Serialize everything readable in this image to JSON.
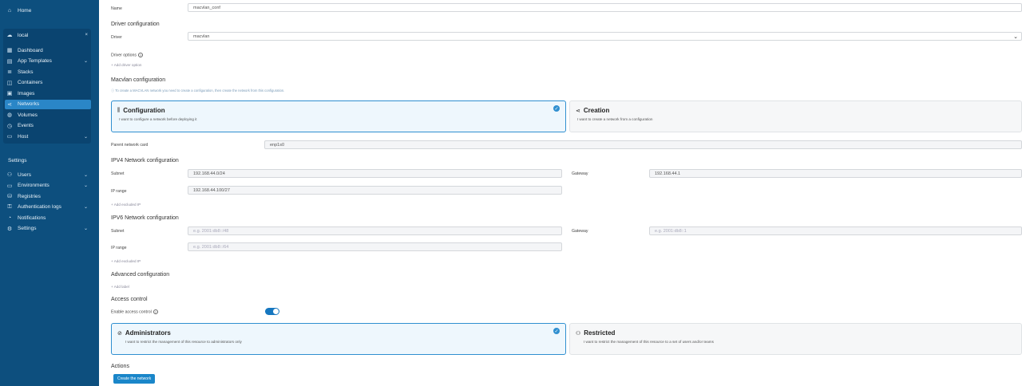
{
  "sidebar": {
    "home": "Home",
    "environment": "local",
    "env_items": [
      {
        "label": "Dashboard",
        "icon": "dashboard-icon"
      },
      {
        "label": "App Templates",
        "icon": "templates-icon"
      },
      {
        "label": "Stacks",
        "icon": "stacks-icon"
      },
      {
        "label": "Containers",
        "icon": "containers-icon"
      },
      {
        "label": "Images",
        "icon": "images-icon"
      },
      {
        "label": "Networks",
        "icon": "networks-icon"
      },
      {
        "label": "Volumes",
        "icon": "volumes-icon"
      },
      {
        "label": "Events",
        "icon": "events-icon"
      },
      {
        "label": "Host",
        "icon": "host-icon"
      }
    ],
    "settings_header": "Settings",
    "settings_items": [
      {
        "label": "Users"
      },
      {
        "label": "Environments"
      },
      {
        "label": "Registries"
      },
      {
        "label": "Authentication logs"
      },
      {
        "label": "Notifications"
      },
      {
        "label": "Settings"
      }
    ]
  },
  "form": {
    "name_label": "Name",
    "name_value": "macvlan_conf",
    "driver_section": "Driver configuration",
    "driver_label": "Driver",
    "driver_value": "macvlan",
    "driver_options_label": "Driver options",
    "add_driver_option": "+ Add driver option",
    "macvlan_section": "Macvlan configuration",
    "macvlan_hint": "To create a MACVLAN network you need to create a configuration, then create the network from this configuration.",
    "config_card": {
      "title": "Configuration",
      "desc": "I want to configure a network before deploying it"
    },
    "creation_card": {
      "title": "Creation",
      "desc": "I want to create a network from a configuration"
    },
    "parent_card_label": "Parent network card",
    "parent_card_value": "enp1s0",
    "ipv4_section": "IPV4 Network configuration",
    "ipv4_subnet_label": "Subnet",
    "ipv4_subnet_value": "192.168.44.0/24",
    "ipv4_gateway_label": "Gateway",
    "ipv4_gateway_value": "192.168.44.1",
    "ipv4_range_label": "IP range",
    "ipv4_range_value": "192.168.44.100/27",
    "ipv4_add_excluded": "+ Add excluded IP",
    "ipv6_section": "IPV6 Network configuration",
    "ipv6_subnet_label": "Subnet",
    "ipv6_subnet_placeholder": "e.g. 2001:db8::/48",
    "ipv6_gateway_label": "Gateway",
    "ipv6_gateway_placeholder": "e.g. 2001:db8::1",
    "ipv6_range_label": "IP range",
    "ipv6_range_placeholder": "e.g. 2001:db8::/64",
    "ipv6_add_excluded": "+ Add excluded IP",
    "advanced_section": "Advanced configuration",
    "add_label": "+ Add label",
    "access_section": "Access control",
    "enable_access_label": "Enable access control",
    "enable_access_on": true,
    "admin_card": {
      "title": "Administrators",
      "desc": "I want to restrict the management of this resource to administrators only"
    },
    "restricted_card": {
      "title": "Restricted",
      "desc": "I want to restrict the management of this resource to a set of users and/or teams"
    },
    "actions_section": "Actions",
    "create_button": "Create the network"
  },
  "colors": {
    "sidebar_bg": "#0d4f7e",
    "active_item": "#2a86c7",
    "accent": "#1a86c9"
  }
}
